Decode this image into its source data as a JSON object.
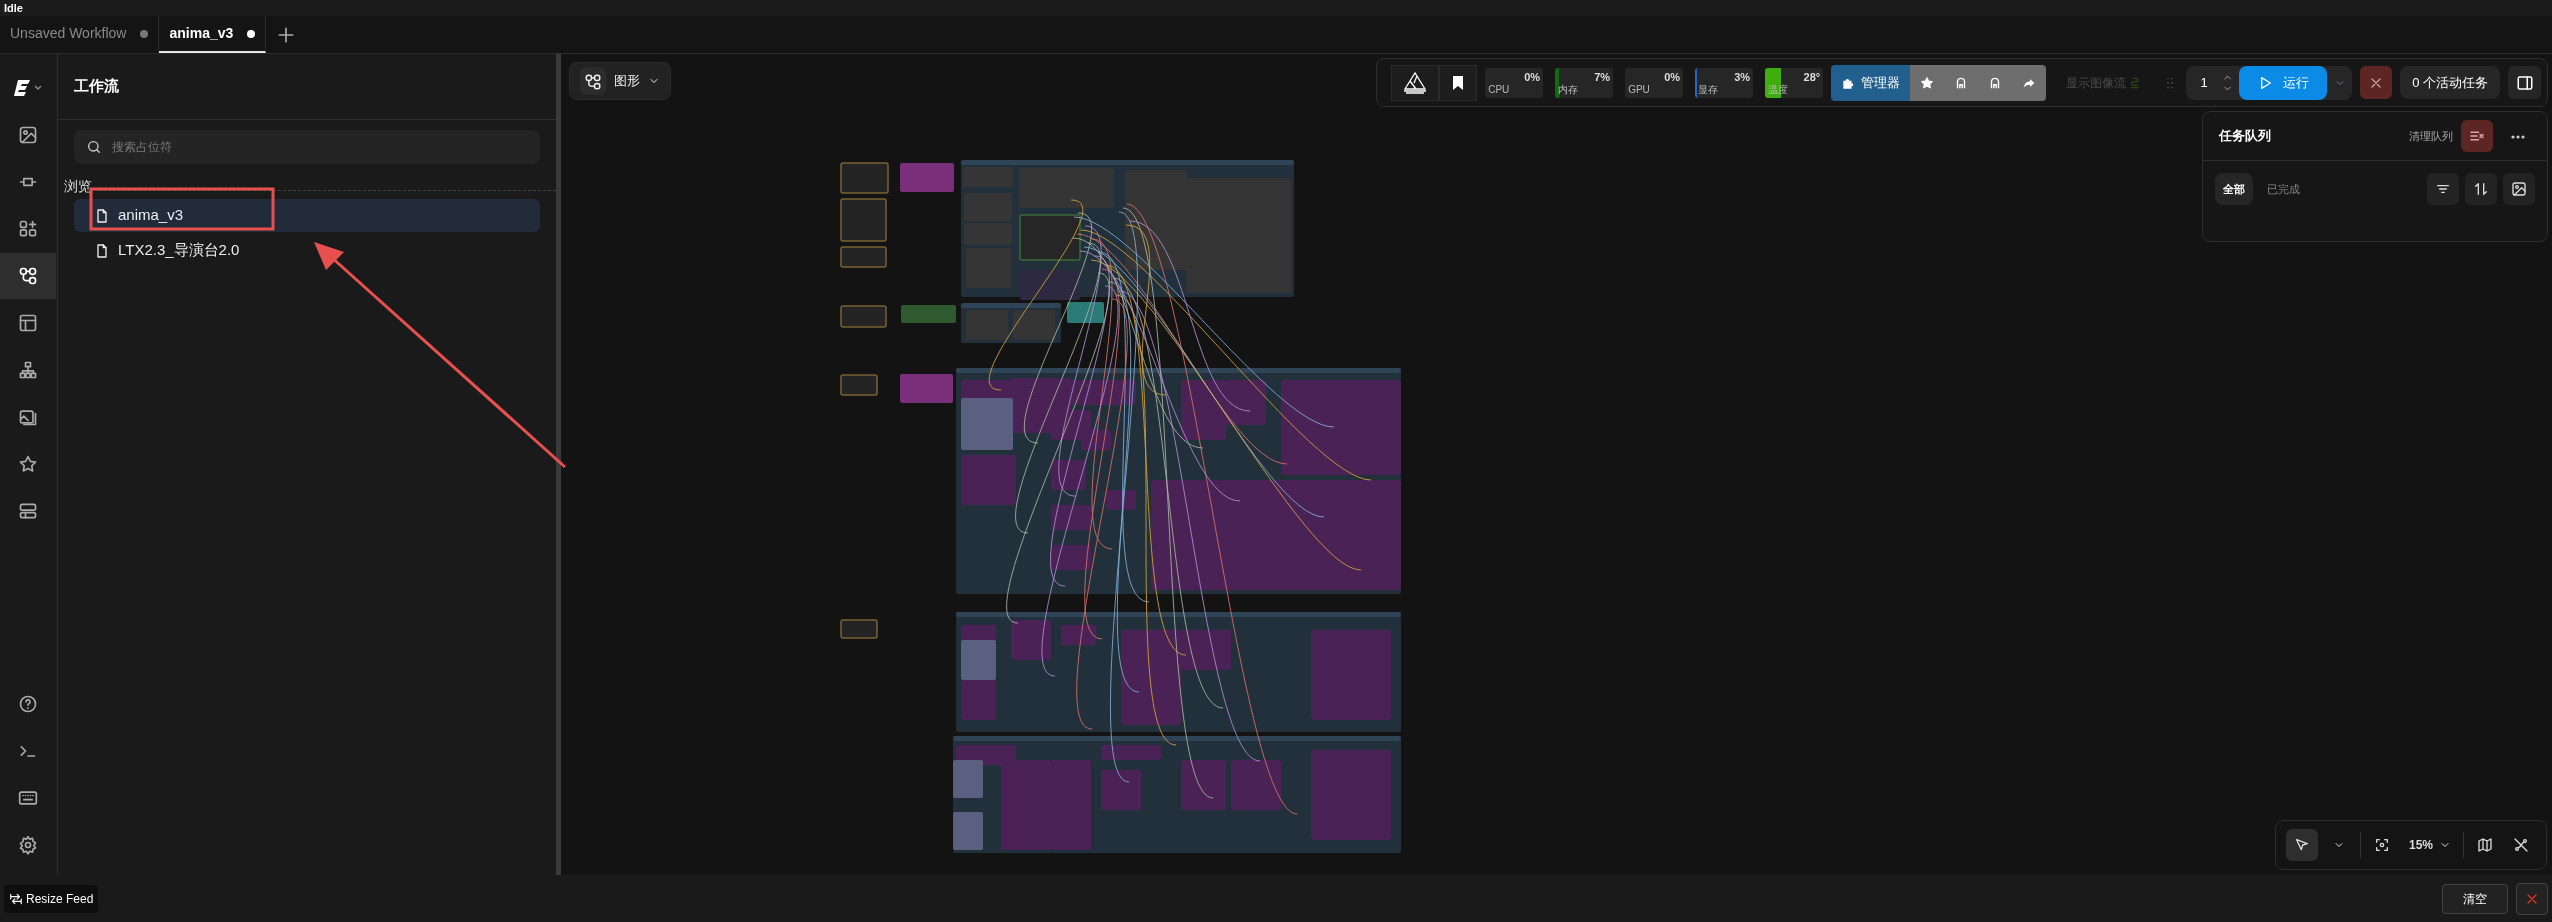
{
  "window": {
    "title": "Idle"
  },
  "tabs": [
    {
      "label": "Unsaved Workflow",
      "selected": false,
      "modified": true
    },
    {
      "label": "anima_v3",
      "selected": true,
      "modified": true
    }
  ],
  "rail": {
    "items": [
      {
        "selected": false
      },
      {
        "selected": false
      },
      {
        "selected": false
      },
      {
        "selected": true
      },
      {
        "selected": false
      },
      {
        "selected": false
      },
      {
        "selected": false
      },
      {
        "selected": false
      },
      {
        "selected": false
      }
    ]
  },
  "sidebar": {
    "title": "工作流",
    "search": {
      "placeholder": "搜索占位符"
    },
    "section": "浏览",
    "items": [
      {
        "label": "anima_v3",
        "selected": true
      },
      {
        "label": "LTX2.3_导演台2.0",
        "selected": false
      }
    ]
  },
  "canvas": {
    "view_button": "图形",
    "select_mode": true,
    "zoom": "15%"
  },
  "toolbar": {
    "monitors": [
      {
        "label": "CPU",
        "value": "0%",
        "level": 0
      },
      {
        "label": "内存",
        "value": "7%",
        "level": 0.07,
        "color": "#0e6b12"
      },
      {
        "label": "GPU",
        "value": "0%",
        "level": 0
      },
      {
        "label": "显存",
        "value": "3%",
        "level": 0.03,
        "color": "#2566c4"
      },
      {
        "label": "温度",
        "value": "28°",
        "level": 0.28,
        "color": "#3fae0c"
      }
    ],
    "manager": "管理器",
    "image_feed": {
      "label": "显示图像流",
      "disabled": true
    },
    "batch": "1",
    "run": "运行",
    "active_tasks": "0 个活动任务"
  },
  "queue": {
    "title": "任务队列",
    "clear": "清理队列",
    "filters": [
      {
        "label": "全部",
        "selected": true
      },
      {
        "label": "已完成",
        "selected": false
      }
    ]
  },
  "bottom_bar": {
    "resize": "Resize Feed",
    "clear": "清空"
  }
}
